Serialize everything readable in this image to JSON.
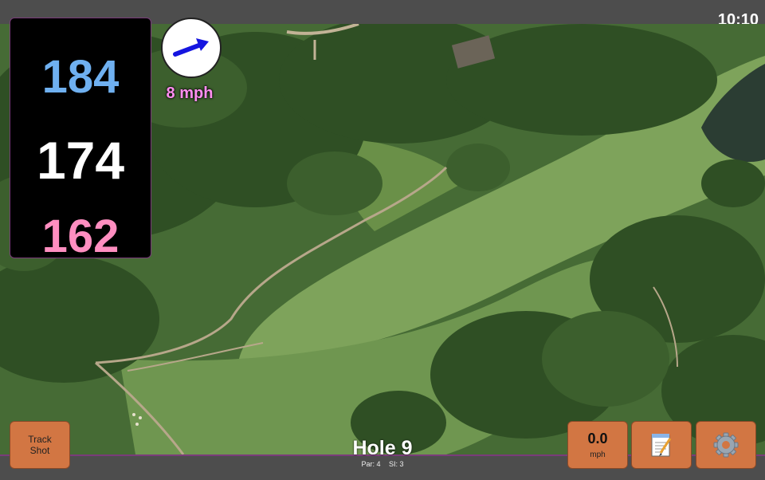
{
  "status": {
    "time": "10:10"
  },
  "yardages": {
    "back": "184",
    "middle": "174",
    "front": "162"
  },
  "wind": {
    "speed_text": "8 mph",
    "arrow_color": "#1515e0",
    "icon": "wind-direction-arrow"
  },
  "buttons": {
    "track_shot": {
      "line1": "Track",
      "line2": "Shot"
    },
    "speed": {
      "value": "0.0",
      "unit": "mph"
    },
    "notes": {
      "icon": "notepad-icon"
    },
    "settings": {
      "icon": "gear-icon"
    }
  },
  "hole": {
    "title": "Hole 9",
    "par": "Par: 4",
    "si": "SI: 3"
  },
  "colors": {
    "back_yardage": "#6fb0f0",
    "middle_yardage": "#ffffff",
    "front_yardage": "#ff8ec0",
    "button_bg": "#d27643",
    "bar_bg": "#4d4d4d",
    "accent_border": "#7a3b7a"
  }
}
